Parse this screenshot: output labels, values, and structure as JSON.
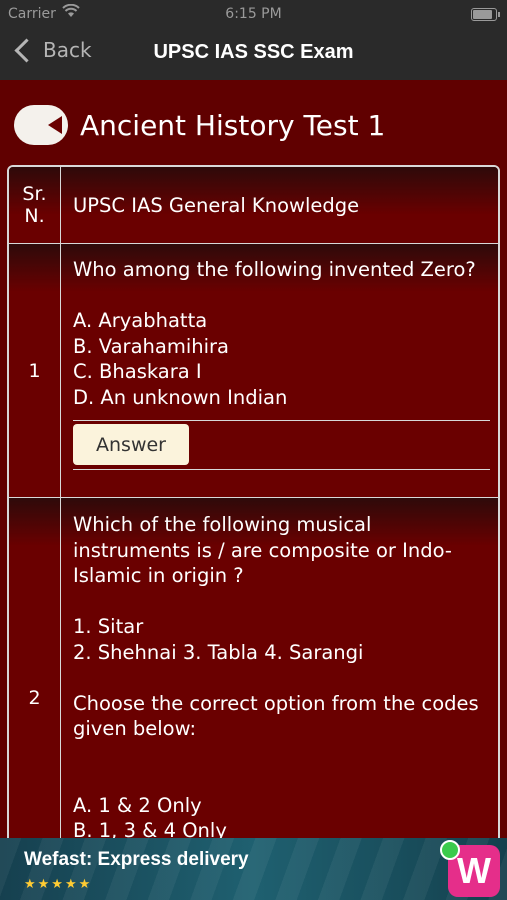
{
  "status_bar": {
    "carrier": "Carrier",
    "time": "6:15 PM"
  },
  "nav": {
    "back_label": "Back",
    "title": "UPSC IAS SSC Exam"
  },
  "test_title": "Ancient History Test 1",
  "table": {
    "header": {
      "sr": "Sr.\nN.",
      "subject": "UPSC IAS General Knowledge"
    },
    "rows": [
      {
        "sr": "1",
        "lines": [
          "Who among the following invented Zero?",
          "",
          "A. Aryabhatta",
          "B. Varahamihira",
          "C. Bhaskara I",
          "D. An unknown Indian"
        ],
        "answer_label": "Answer"
      },
      {
        "sr": "2",
        "lines": [
          "Which of the following musical",
          "instruments is / are composite or Indo-",
          "Islamic in origin ?",
          "",
          "1. Sitar",
          "2. Shehnai 3. Tabla 4. Sarangi",
          "",
          "Choose the correct option from the codes",
          "given below:",
          "",
          "",
          "A. 1 & 2 Only",
          "B. 1, 3 & 4 Only"
        ]
      }
    ]
  },
  "ad": {
    "title": "Wefast: Express delivery",
    "rating": "★★★★★",
    "logo_letter": "W"
  }
}
